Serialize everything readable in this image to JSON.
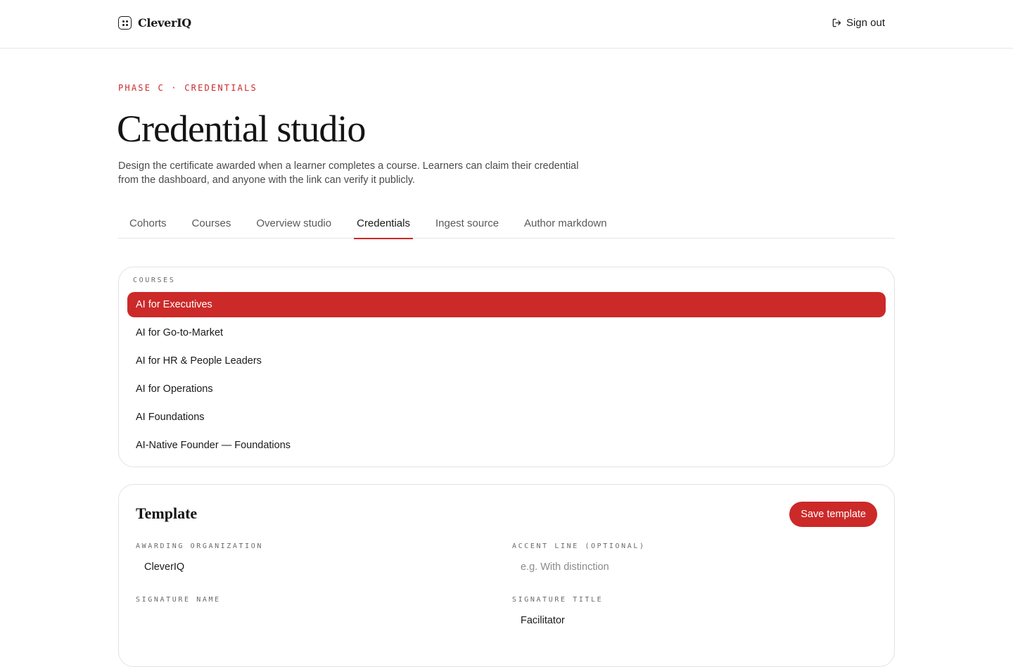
{
  "header": {
    "brand": "CleverIQ",
    "sign_out": "Sign out"
  },
  "hero": {
    "eyebrow": "PHASE C · CREDENTIALS",
    "title": "Credential studio",
    "intro": "Design the certificate awarded when a learner completes a course. Learners can claim their credential from the dashboard, and anyone with the link can verify it publicly."
  },
  "tabs": [
    {
      "label": "Cohorts",
      "active": false
    },
    {
      "label": "Courses",
      "active": false
    },
    {
      "label": "Overview studio",
      "active": false
    },
    {
      "label": "Credentials",
      "active": true
    },
    {
      "label": "Ingest source",
      "active": false
    },
    {
      "label": "Author markdown",
      "active": false
    }
  ],
  "courses": {
    "label": "COURSES",
    "items": [
      {
        "label": "AI for Executives",
        "selected": true
      },
      {
        "label": "AI for Go-to-Market",
        "selected": false
      },
      {
        "label": "AI for HR & People Leaders",
        "selected": false
      },
      {
        "label": "AI for Operations",
        "selected": false
      },
      {
        "label": "AI Foundations",
        "selected": false
      },
      {
        "label": "AI-Native Founder — Foundations",
        "selected": false
      }
    ]
  },
  "template": {
    "title": "Template",
    "save_label": "Save template",
    "awarding_org": {
      "label": "AWARDING ORGANIZATION",
      "value": "CleverIQ",
      "placeholder": ""
    },
    "accent_line": {
      "label": "ACCENT LINE (OPTIONAL)",
      "value": "",
      "placeholder": "e.g. With distinction"
    },
    "signature_name": {
      "label": "SIGNATURE NAME",
      "value": "",
      "placeholder": ""
    },
    "signature_title": {
      "label": "SIGNATURE TITLE",
      "value": "Facilitator",
      "placeholder": ""
    }
  },
  "colors": {
    "accent": "#cc2929",
    "text": "#1a1a1a",
    "border": "#e3e3e3"
  },
  "icons": {
    "brand": "brand-grid-icon",
    "sign_out": "sign-out-icon"
  }
}
